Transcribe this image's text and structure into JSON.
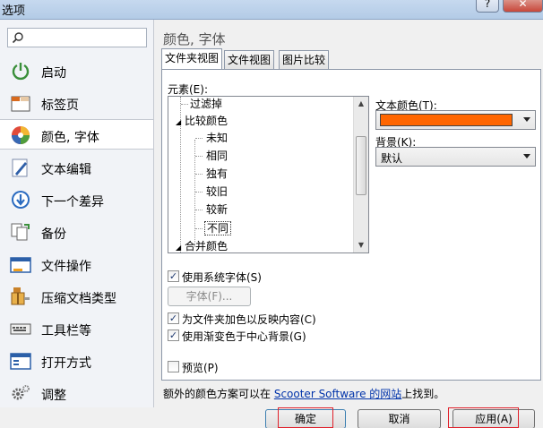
{
  "window": {
    "title": "选项",
    "help_label": "?",
    "close_label": "✕"
  },
  "sidebar": {
    "search_placeholder": "",
    "items": [
      {
        "label": "启动",
        "icon": "power-icon"
      },
      {
        "label": "标签页",
        "icon": "tabs-icon"
      },
      {
        "label": "颜色, 字体",
        "icon": "color-wheel-icon",
        "selected": true
      },
      {
        "label": "文本编辑",
        "icon": "pencil-icon"
      },
      {
        "label": "下一个差异",
        "icon": "down-arrow-icon"
      },
      {
        "label": "备份",
        "icon": "backup-icon"
      },
      {
        "label": "文件操作",
        "icon": "file-operation-icon"
      },
      {
        "label": "压缩文档类型",
        "icon": "archive-icon"
      },
      {
        "label": "工具栏等",
        "icon": "toolbar-icon"
      },
      {
        "label": "打开方式",
        "icon": "open-with-icon"
      },
      {
        "label": "调整",
        "icon": "gear-icon"
      }
    ]
  },
  "main": {
    "title": "颜色, 字体",
    "tabs": [
      {
        "label": "文件夹视图",
        "active": true
      },
      {
        "label": "文件视图",
        "active": false
      },
      {
        "label": "图片比较",
        "active": false
      }
    ],
    "elements_label": "元素(E):",
    "tree": [
      {
        "label": "过滤掉",
        "level": 1
      },
      {
        "label": "比较颜色",
        "level": 1,
        "expanded": true
      },
      {
        "label": "未知",
        "level": 2
      },
      {
        "label": "相同",
        "level": 2
      },
      {
        "label": "独有",
        "level": 2
      },
      {
        "label": "较旧",
        "level": 2
      },
      {
        "label": "较新",
        "level": 2
      },
      {
        "label": "不同",
        "level": 2,
        "selected": true
      },
      {
        "label": "合并颜色",
        "level": 1,
        "expanded": true
      }
    ],
    "text_color_label": "文本颜色(T):",
    "text_color_value": "#ff6600",
    "background_label": "背景(K):",
    "background_value": "默认",
    "use_system_font_label": "使用系统字体(S)",
    "use_system_font_checked": true,
    "font_button_label": "字体(F)...",
    "color_folders_label": "为文件夹加色以反映内容(C)",
    "color_folders_checked": true,
    "gradient_label": "使用渐变色于中心背景(G)",
    "gradient_checked": true,
    "preview_label": "预览(P)",
    "preview_checked": false,
    "footer_prefix": "额外的颜色方案可以在 ",
    "footer_link": "Scooter Software 的网站",
    "footer_suffix": "上找到。"
  },
  "buttons": {
    "ok": "确定",
    "cancel": "取消",
    "apply": "应用(A)"
  },
  "colors": {
    "accent_red": "#e0202a",
    "link_blue": "#0033aa",
    "swatch_orange": "#ff6600"
  }
}
